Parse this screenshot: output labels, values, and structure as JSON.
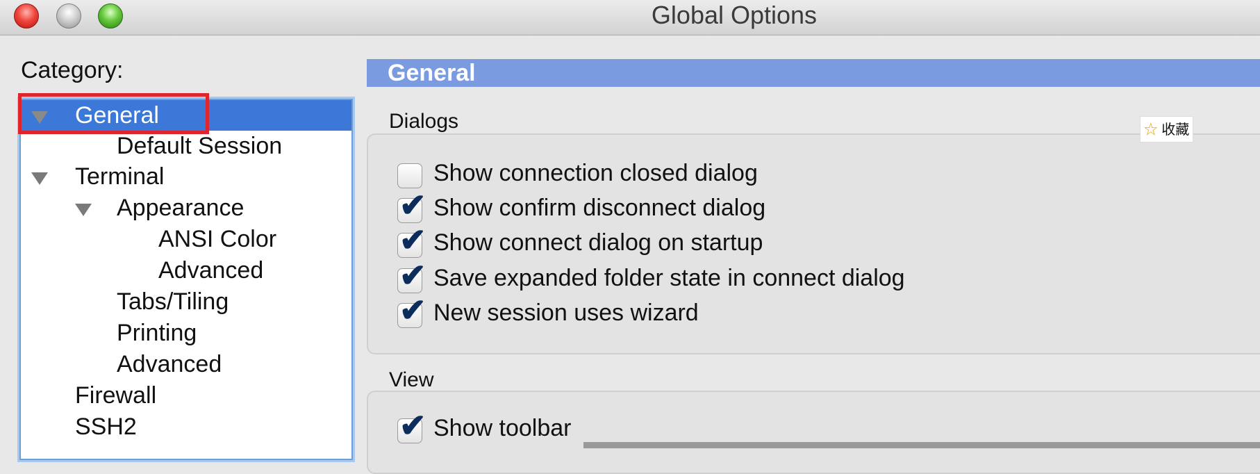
{
  "window": {
    "title": "Global Options"
  },
  "category": {
    "label": "Category:",
    "items": [
      {
        "label": "General",
        "selected": true,
        "expander": true
      },
      {
        "label": "Default Session"
      },
      {
        "label": "Terminal",
        "expander": true
      },
      {
        "label": "Appearance",
        "expander": true
      },
      {
        "label": "ANSI Color"
      },
      {
        "label": "Advanced"
      },
      {
        "label": "Tabs/Tiling"
      },
      {
        "label": "Printing"
      },
      {
        "label": "Advanced"
      },
      {
        "label": "Firewall"
      },
      {
        "label": "SSH2"
      }
    ]
  },
  "panel": {
    "header": "General",
    "dialogs": {
      "label": "Dialogs",
      "options": [
        {
          "label": "Show connection closed dialog",
          "checked": false
        },
        {
          "label": "Show confirm disconnect dialog",
          "checked": true
        },
        {
          "label": "Show connect dialog on startup",
          "checked": true
        },
        {
          "label": "Save expanded folder state in connect dialog",
          "checked": true
        },
        {
          "label": "New session uses wizard",
          "checked": true
        }
      ]
    },
    "view": {
      "label": "View",
      "options": [
        {
          "label": "Show toolbar",
          "checked": true
        }
      ]
    }
  },
  "favorite": {
    "icon": "star-icon",
    "label": "收藏"
  },
  "colors": {
    "selection": "#3b78d8",
    "header": "#7b9be0",
    "highlight": "#e0242c"
  }
}
